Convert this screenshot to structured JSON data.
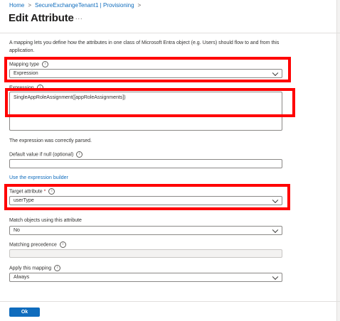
{
  "breadcrumb": {
    "home": "Home",
    "tenant": "SecureExchangeTenant1 | Provisioning",
    "separator": ">"
  },
  "page_title": "Edit Attribute",
  "more_icon": "...",
  "description": "A mapping lets you define how the attributes in one class of Microsoft Entra object (e.g. Users) should flow to and from this application.",
  "mapping_type": {
    "label": "Mapping type",
    "value": "Expression"
  },
  "expression": {
    "label": "Expression",
    "value": "SingleAppRoleAssignment([appRoleAssignments])"
  },
  "parse_status": "The expression was correctly parsed.",
  "default_value": {
    "label": "Default value if null (optional)",
    "value": ""
  },
  "expression_builder_link": "Use the expression builder",
  "target_attribute": {
    "label": "Target attribute",
    "required_marker": "*",
    "value": "userType"
  },
  "match_objects": {
    "label": "Match objects using this attribute",
    "value": "No"
  },
  "matching_precedence": {
    "label": "Matching precedence",
    "value": ""
  },
  "apply_mapping": {
    "label": "Apply this mapping",
    "value": "Always"
  },
  "info_glyph": "i",
  "ok_button": "Ok",
  "colors": {
    "accent": "#0f6cbd",
    "highlight": "#ff0000",
    "border": "#8a8886"
  }
}
